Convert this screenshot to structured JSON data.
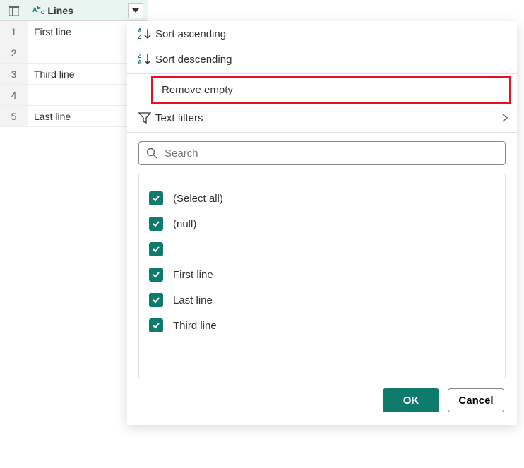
{
  "table": {
    "column_name": "Lines",
    "rows": [
      {
        "num": "1",
        "value": "First line"
      },
      {
        "num": "2",
        "value": ""
      },
      {
        "num": "3",
        "value": "Third line"
      },
      {
        "num": "4",
        "value": ""
      },
      {
        "num": "5",
        "value": "Last line"
      }
    ]
  },
  "menu": {
    "sort_asc": "Sort ascending",
    "sort_desc": "Sort descending",
    "remove_empty": "Remove empty",
    "text_filters": "Text filters"
  },
  "search": {
    "placeholder": "Search"
  },
  "filters": {
    "select_all": "(Select all)",
    "null_item": "(null)",
    "empty_item": "",
    "item_first": "First line",
    "item_last": "Last line",
    "item_third": "Third line"
  },
  "buttons": {
    "ok": "OK",
    "cancel": "Cancel"
  }
}
